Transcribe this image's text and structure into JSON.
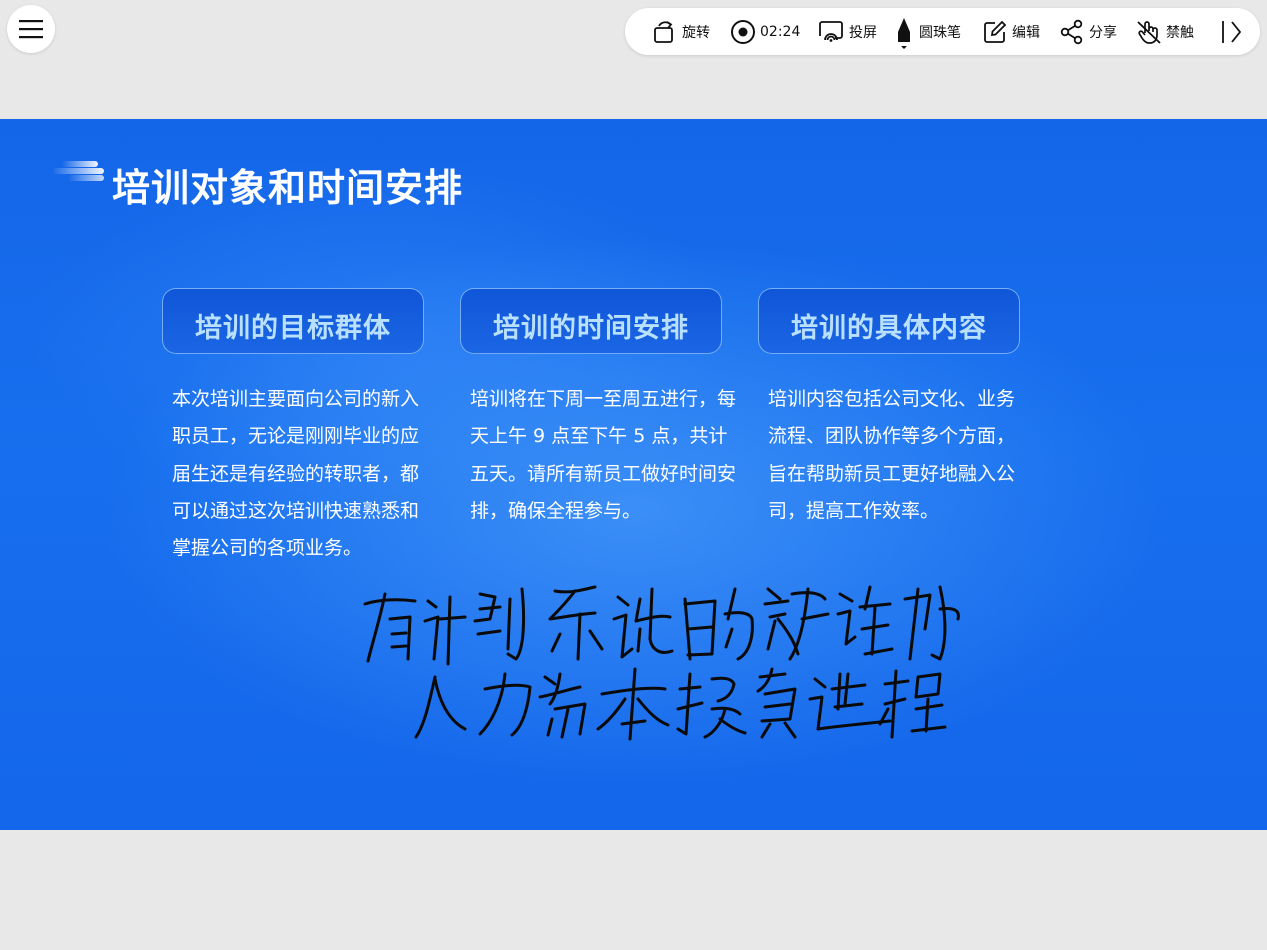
{
  "toolbar": {
    "rotate": {
      "label": "旋转",
      "icon": "rotate-icon"
    },
    "timer": {
      "label": "02:24",
      "icon": "record-icon"
    },
    "cast": {
      "label": "投屏",
      "icon": "cast-icon"
    },
    "pen": {
      "label": "圆珠笔",
      "icon": "pen-icon"
    },
    "edit": {
      "label": "编辑",
      "icon": "edit-icon"
    },
    "share": {
      "label": "分享",
      "icon": "share-icon"
    },
    "touch": {
      "label": "禁触",
      "icon": "no-touch-icon"
    },
    "collapse": {
      "icon": "collapse-icon"
    }
  },
  "slide": {
    "title": "培训对象和时间安排",
    "cards": [
      {
        "heading": "培训的目标群体",
        "body": "本次培训主要面向公司的新入职员工，无论是刚刚毕业的应届生还是有经验的转职者，都可以通过这次培训快速熟悉和掌握公司的各项业务。"
      },
      {
        "heading": "培训的时间安排",
        "body": "培训将在下周一至周五进行，每天上午 9 点至下午 5 点，共计五天。请所有新员工做好时间安排，确保全程参与。"
      },
      {
        "heading": "培训的具体内容",
        "body": "培训内容包括公司文化、业务流程、团队协作等多个方面，旨在帮助新员工更好地融入公司，提高工作效率。"
      }
    ],
    "handwriting": [
      "有计划系统的教学活动",
      "人力资本投资过程"
    ]
  },
  "colors": {
    "slide_blue": "#1466e8",
    "card_heading_text": "#b9e1ff",
    "ink": "#0a0a0a",
    "toolbar_bg": "#ffffff",
    "page_bg": "#e8e8e8"
  }
}
